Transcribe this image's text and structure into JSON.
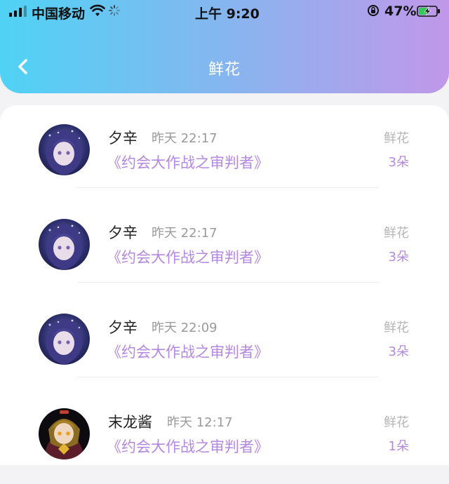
{
  "status_bar": {
    "carrier": "中国移动",
    "time": "上午 9:20",
    "battery": "47%"
  },
  "header": {
    "title": "鲜花"
  },
  "records": [
    {
      "name": "夕辛",
      "time": "昨天 22:17",
      "gift": "《约会大作战之审判者》",
      "type": "鲜花",
      "count": "3朵",
      "avatar": "avatar-purple"
    },
    {
      "name": "夕辛",
      "time": "昨天 22:17",
      "gift": "《约会大作战之审判者》",
      "type": "鲜花",
      "count": "3朵",
      "avatar": "avatar-purple"
    },
    {
      "name": "夕辛",
      "time": "昨天 22:09",
      "gift": "《约会大作战之审判者》",
      "type": "鲜花",
      "count": "3朵",
      "avatar": "avatar-purple"
    },
    {
      "name": "末龙酱",
      "time": "昨天 12:17",
      "gift": "《约会大作战之审判者》",
      "type": "鲜花",
      "count": "1朵",
      "avatar": "avatar-dark"
    }
  ],
  "colors": {
    "accent": "#b488e2",
    "header_gradient": [
      "#4fd3f5",
      "#86b6ef",
      "#c197ea"
    ]
  }
}
